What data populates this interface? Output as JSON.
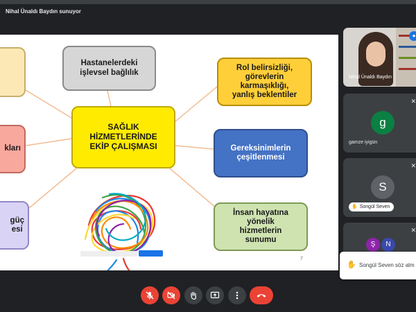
{
  "meeting": {
    "presenter_text": "Nihal Ünaldı Baydın sunuyor"
  },
  "slide": {
    "center": [
      "SAĞLIK",
      "HİZMETLERİNDE",
      "EKİP ÇALIŞMASI"
    ],
    "nodes": {
      "hastane": [
        "Hastanelerdeki",
        "işlevsel bağlılık"
      ],
      "rol": [
        "Rol belirsizliği,",
        "görevlerin",
        "karmaşıklığı,",
        "yanlış beklentiler"
      ],
      "gereksinim": [
        "Gereksinimlerin",
        "çeşitlenmesi"
      ],
      "insan": [
        "İnsan hayatına",
        "yönelik",
        "hizmetlerin",
        "sunumu"
      ],
      "left2": "kları",
      "left3": [
        "güç",
        "esi"
      ]
    },
    "page_number": "7",
    "colors": {
      "center": "#ffeb00",
      "gray": "#d6d6d6",
      "orange": "#ffcf3a",
      "blue": "#4472c4",
      "green": "#cfe3b1",
      "salmon": "#f9a89e",
      "lavender": "#d9d4f5",
      "cream": "#fbe8b5"
    }
  },
  "participants": [
    {
      "name": "Nihal Ünaldı Baydın",
      "speaking": true
    },
    {
      "name": "gamze iyigün",
      "initial": "g",
      "muted": true
    },
    {
      "name": "Songül Seven",
      "initial": "S",
      "muted": true,
      "icon": "hand-icon"
    },
    {
      "initials": [
        "Ş",
        "N"
      ],
      "muted": true
    }
  ],
  "toast": {
    "text": "Songül Seven söz alm",
    "icon": "hand-raise-icon"
  },
  "controls": [
    {
      "name": "mic-off-button",
      "icon": "mic-off-icon",
      "color": "#ea4335"
    },
    {
      "name": "camera-off-button",
      "icon": "camera-off-icon",
      "color": "#ea4335"
    },
    {
      "name": "raise-hand-button",
      "icon": "hand-icon",
      "color": "#3c4043"
    },
    {
      "name": "present-button",
      "icon": "present-icon",
      "color": "#3c4043"
    },
    {
      "name": "more-options-button",
      "icon": "more-vert-icon",
      "color": "#3c4043"
    },
    {
      "name": "leave-call-button",
      "icon": "phone-hangup-icon",
      "color": "#ea4335"
    }
  ]
}
